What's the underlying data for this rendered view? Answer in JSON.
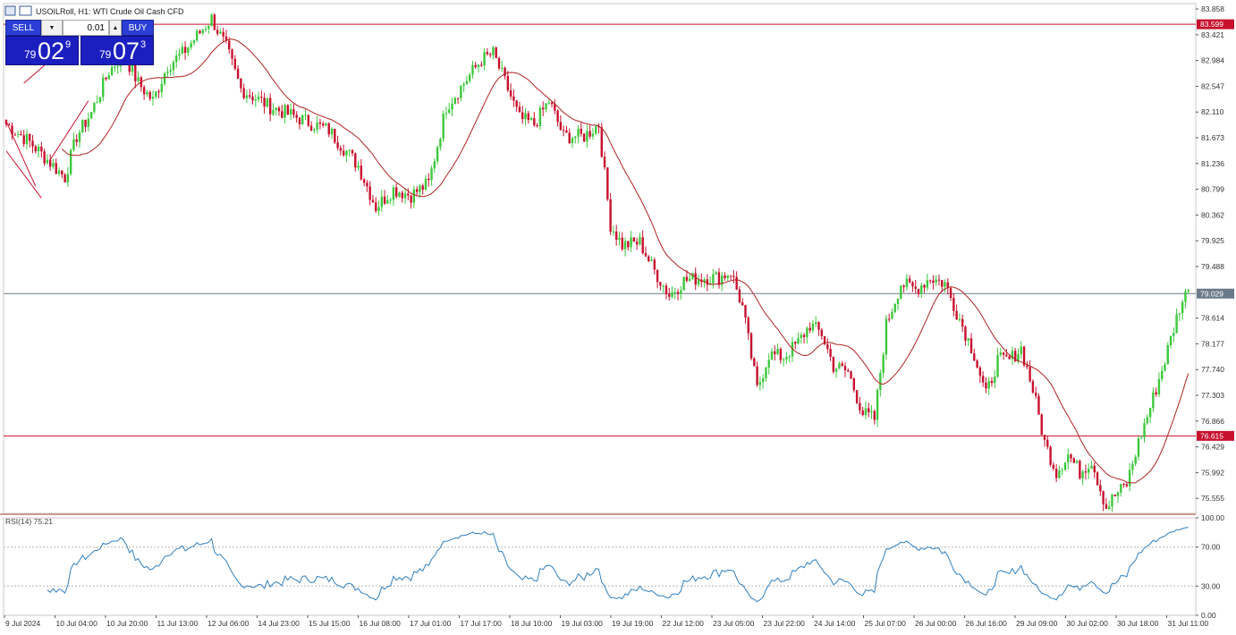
{
  "header": {
    "symbol_title": "USOILRoll, H1:  WTI Crude Oil Cash CFD",
    "icons": [
      "chart-grid-icon",
      "chart-window-icon"
    ]
  },
  "trade_panel": {
    "sell_label": "SELL",
    "buy_label": "BUY",
    "lot_value": "0.01",
    "sell_price": {
      "prefix": "79",
      "big": "02",
      "sup": "9"
    },
    "buy_price": {
      "prefix": "79",
      "big": "07",
      "sup": "3"
    }
  },
  "price_axis": {
    "ticks": [
      "83.858",
      "83.421",
      "82.984",
      "82.547",
      "82.110",
      "81.673",
      "81.236",
      "80.799",
      "80.362",
      "79.925",
      "79.488",
      "78.614",
      "78.177",
      "77.740",
      "77.303",
      "76.866",
      "76.429",
      "75.992",
      "75.555"
    ],
    "levels": [
      {
        "label": "83.599",
        "value": 83.599,
        "color": "#c8102e"
      },
      {
        "label": "79.029",
        "value": 79.029,
        "color": "#6b7a8a"
      },
      {
        "label": "76.615",
        "value": 76.615,
        "color": "#c8102e"
      }
    ]
  },
  "rsi": {
    "label": "RSI(14) 75.21",
    "ticks": [
      "100.00",
      "70.00",
      "30.00",
      "0.00"
    ],
    "color": "#2f7fc1"
  },
  "time_axis": {
    "labels": [
      "9 Jul 2024",
      "10 Jul 04:00",
      "10 Jul 20:00",
      "11 Jul 13:00",
      "12 Jul 06:00",
      "14 Jul 23:00",
      "15 Jul 15:00",
      "16 Jul 08:00",
      "17 Jul 01:00",
      "17 Jul 17:00",
      "18 Jul 10:00",
      "19 Jul 03:00",
      "19 Jul 19:00",
      "22 Jul 12:00",
      "23 Jul 05:00",
      "23 Jul 22:00",
      "24 Jul 14:00",
      "25 Jul 07:00",
      "26 Jul 00:00",
      "26 Jul 16:00",
      "29 Jul 09:00",
      "30 Jul 02:00",
      "30 Jul 18:00",
      "31 Jul 11:00"
    ]
  },
  "colors": {
    "bull": "#3cc83c",
    "bear": "#c8102e",
    "ma": "#b22222",
    "channel": "#c8102e",
    "axis_text": "#333333"
  },
  "chart_data": {
    "type": "candlestick",
    "ylim": [
      75.3,
      83.95
    ],
    "anchors": [
      [
        0,
        81.9
      ],
      [
        8,
        81.6
      ],
      [
        16,
        81.2
      ],
      [
        20,
        81.0
      ],
      [
        24,
        81.7
      ],
      [
        29,
        82.1
      ],
      [
        35,
        82.8
      ],
      [
        40,
        83.1
      ],
      [
        45,
        82.6
      ],
      [
        50,
        82.3
      ],
      [
        55,
        82.9
      ],
      [
        60,
        83.1
      ],
      [
        65,
        83.4
      ],
      [
        70,
        83.7
      ],
      [
        75,
        83.2
      ],
      [
        80,
        82.5
      ],
      [
        90,
        82.2
      ],
      [
        100,
        82.0
      ],
      [
        110,
        81.8
      ],
      [
        120,
        81.2
      ],
      [
        126,
        80.5
      ],
      [
        132,
        80.8
      ],
      [
        138,
        80.7
      ],
      [
        144,
        80.9
      ],
      [
        150,
        82.2
      ],
      [
        156,
        82.6
      ],
      [
        162,
        83.0
      ],
      [
        166,
        83.1
      ],
      [
        171,
        82.5
      ],
      [
        175,
        82.0
      ],
      [
        180,
        81.9
      ],
      [
        185,
        82.3
      ],
      [
        190,
        81.7
      ],
      [
        197,
        81.7
      ],
      [
        202,
        81.9
      ],
      [
        206,
        80.2
      ],
      [
        210,
        79.85
      ],
      [
        216,
        79.9
      ],
      [
        220,
        79.5
      ],
      [
        226,
        79.0
      ],
      [
        231,
        79.25
      ],
      [
        237,
        79.3
      ],
      [
        243,
        79.3
      ],
      [
        247,
        79.4
      ],
      [
        251,
        78.8
      ],
      [
        256,
        77.4
      ],
      [
        260,
        78.0
      ],
      [
        265,
        77.95
      ],
      [
        270,
        78.2
      ],
      [
        274,
        78.5
      ],
      [
        278,
        78.35
      ],
      [
        282,
        77.8
      ],
      [
        287,
        77.7
      ],
      [
        292,
        77.0
      ],
      [
        296,
        76.9
      ],
      [
        300,
        78.5
      ],
      [
        305,
        79.2
      ],
      [
        310,
        79.1
      ],
      [
        315,
        79.3
      ],
      [
        320,
        79.2
      ],
      [
        325,
        78.6
      ],
      [
        330,
        78.0
      ],
      [
        334,
        77.3
      ],
      [
        338,
        77.9
      ],
      [
        342,
        77.9
      ],
      [
        346,
        78.1
      ],
      [
        350,
        77.4
      ],
      [
        354,
        76.5
      ],
      [
        358,
        76.0
      ],
      [
        362,
        76.3
      ],
      [
        366,
        76.0
      ],
      [
        370,
        76.2
      ],
      [
        375,
        75.4
      ],
      [
        378,
        75.6
      ],
      [
        382,
        75.8
      ],
      [
        386,
        76.5
      ],
      [
        390,
        77.1
      ],
      [
        395,
        77.9
      ],
      [
        400,
        78.8
      ],
      [
        403,
        79.1
      ]
    ],
    "ma_period": 20,
    "rsi_period": 14,
    "rsi_levels": [
      70,
      30
    ],
    "channels": [
      {
        "points": [
          [
            0,
            81.95
          ],
          [
            10,
            80.85
          ]
        ]
      },
      {
        "points": [
          [
            0,
            81.45
          ],
          [
            12,
            80.65
          ]
        ]
      },
      {
        "points": [
          [
            6,
            82.6
          ],
          [
            28,
            83.55
          ]
        ]
      },
      {
        "points": [
          [
            15,
            81.3
          ],
          [
            28,
            82.3
          ]
        ]
      }
    ]
  }
}
